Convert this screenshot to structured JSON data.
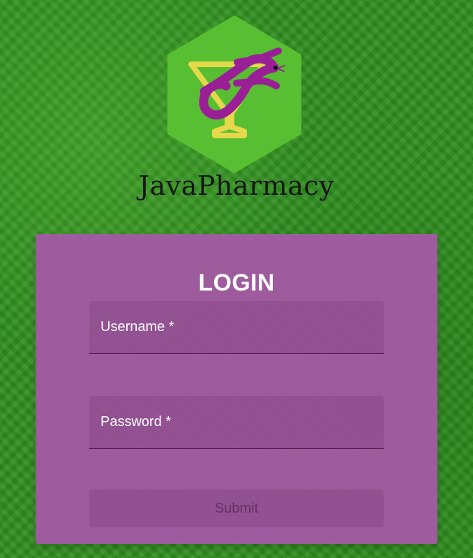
{
  "brand": {
    "name": "JavaPharmacy"
  },
  "login": {
    "title": "LOGIN",
    "username_label": "Username *",
    "username_value": "",
    "password_label": "Password *",
    "password_value": "",
    "submit_label": "Submit"
  },
  "icons": {
    "logo": "pharmacy-logo-icon"
  },
  "colors": {
    "background": "#2f8d1f",
    "hexagon": "#57bf31",
    "card": "#a25aa2",
    "accent_purple": "#9a1f97",
    "accent_yellow": "#e5d84b"
  }
}
